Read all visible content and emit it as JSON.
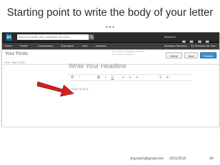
{
  "slide": {
    "title": "Starting point to write the body of your letter …"
  },
  "linkedin": {
    "logo_text": "in",
    "search_placeholder": "Search for people, jobs, companies, and more...",
    "user_text": "Advanced",
    "nav_items": [
      "Home",
      "Profile",
      "Connections",
      "Education",
      "Jobs",
      "Interests",
      "Business Services",
      "Try Premium for free"
    ],
    "posts_heading": "Your Posts",
    "draft_meta": "Draft · May 3, 2015",
    "promo_text": "Join LinkedIn and get the most from your network of friends",
    "buttons": {
      "delete": "Delete",
      "save": "Save",
      "publish": "Publish"
    },
    "headline_placeholder": "Write Your Headline",
    "body_placeholder": "Start writing...",
    "toolbar": [
      "P",
      "”",
      "B",
      "I",
      "U",
      "≡",
      "≡",
      "≡",
      "⚲",
      "⊘"
    ]
  },
  "footer": {
    "email": "jkayrutch@gmail.com",
    "date": "10/11/2015",
    "page": "84"
  },
  "colors": {
    "arrow": "#d81f1f",
    "linkedin_blue": "#0a75b4",
    "publish_blue": "#3a8fd1"
  }
}
